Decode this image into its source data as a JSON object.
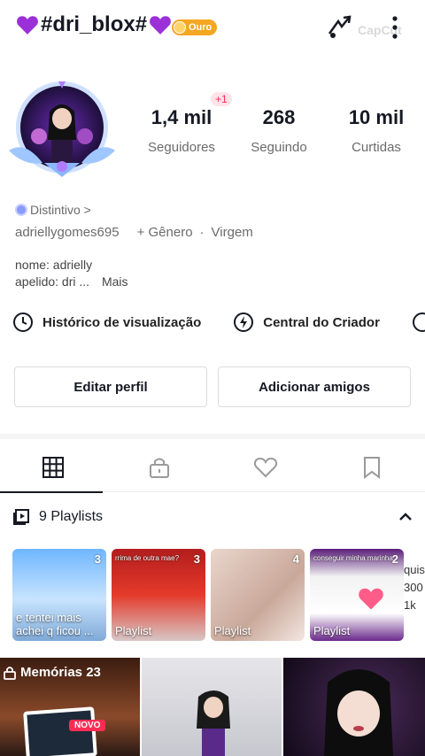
{
  "header": {
    "username": "#dri_blox#",
    "badge": "Ouro",
    "watermark": "CapCut",
    "colors": {
      "heart": "#9b30d9",
      "badge": "#f5a623"
    }
  },
  "profile": {
    "stats": [
      {
        "num": "1,4 mil",
        "label": "Seguidores"
      },
      {
        "num": "268",
        "label": "Seguindo"
      },
      {
        "num": "10 mil",
        "label": "Curtidas"
      }
    ],
    "plus_badge": "+1",
    "distintivo": "Distintivo >",
    "handle": "adriellygomes695",
    "gender": "+ Gênero",
    "separator": "·",
    "sign": "Virgem",
    "bio_line1": "nome: adrielly",
    "bio_line2": "apelido: dri ...",
    "bio_more": "Mais"
  },
  "links": {
    "history": "Histórico de visualização",
    "creator": "Central do Criador"
  },
  "buttons": {
    "edit": "Editar perfil",
    "add": "Adicionar amigos"
  },
  "tabs": [
    "grid-icon",
    "lock-icon",
    "heart-icon",
    "bookmark-icon"
  ],
  "playlists": {
    "title": "9 Playlists",
    "items": [
      {
        "count": "3",
        "caption": "e tentei mais achei q ficou ...",
        "top": ""
      },
      {
        "count": "3",
        "caption": "Playlist",
        "top": "rrima de outra mae?"
      },
      {
        "count": "4",
        "caption": "Playlist",
        "top": ""
      },
      {
        "count": "2",
        "caption": "Playlist",
        "top": "conseguir minha marinha"
      }
    ],
    "partial_text": "quis 300 1k"
  },
  "grid": {
    "memories": "Memórias 23",
    "novo": "NOVO"
  }
}
